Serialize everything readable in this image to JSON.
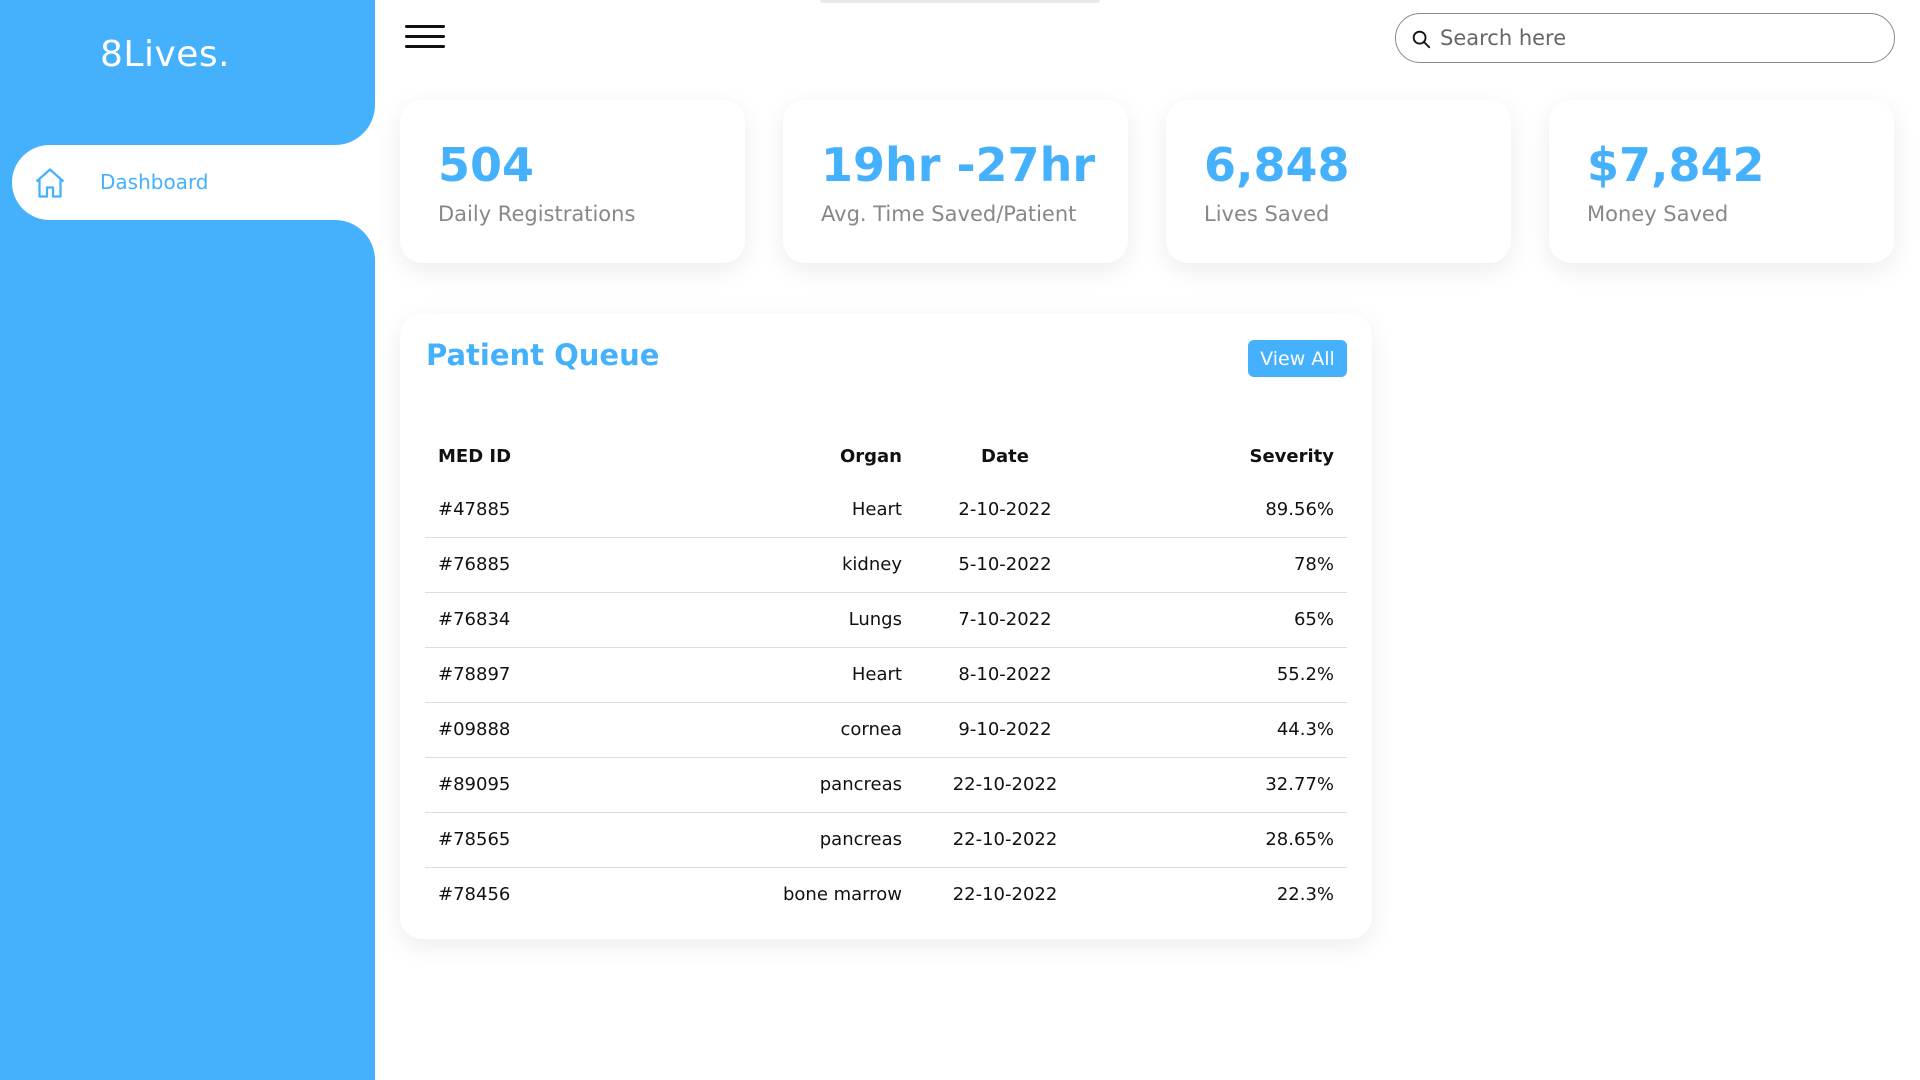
{
  "app": {
    "brand": "8Lives."
  },
  "sidebar": {
    "items": [
      {
        "label": "Dashboard",
        "icon": "home-icon"
      }
    ]
  },
  "topbar": {
    "search_placeholder": "Search here"
  },
  "stats": [
    {
      "value": "504",
      "label": "Daily Registrations"
    },
    {
      "value": "19hr -27hr",
      "label": "Avg. Time Saved/Patient"
    },
    {
      "value": "6,848",
      "label": "Lives Saved"
    },
    {
      "value": "$7,842",
      "label": "Money Saved"
    }
  ],
  "queue": {
    "title": "Patient Queue",
    "view_all": "View All",
    "columns": [
      "MED ID",
      "Organ",
      "Date",
      "Severity"
    ],
    "rows": [
      [
        "#47885",
        "Heart",
        "2-10-2022",
        "89.56%"
      ],
      [
        "#76885",
        "kidney",
        "5-10-2022",
        "78%"
      ],
      [
        "#76834",
        "Lungs",
        "7-10-2022",
        "65%"
      ],
      [
        "#78897",
        "Heart",
        "8-10-2022",
        "55.2%"
      ],
      [
        "#09888",
        "cornea",
        "9-10-2022",
        "44.3%"
      ],
      [
        "#89095",
        "pancreas",
        "22-10-2022",
        "32.77%"
      ],
      [
        "#78565",
        "pancreas",
        "22-10-2022",
        "28.65%"
      ],
      [
        "#78456",
        "bone marrow",
        "22-10-2022",
        "22.3%"
      ]
    ]
  },
  "colors": {
    "accent": "#45b1fd",
    "muted": "#888888"
  }
}
